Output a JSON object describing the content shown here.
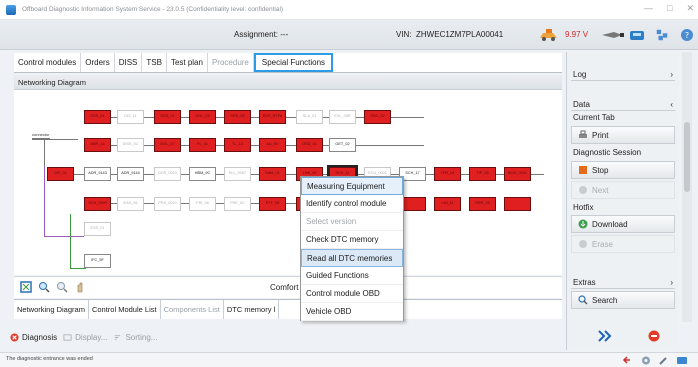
{
  "window": {
    "title": "Offboard Diagnostic Information System Service - 23.0.5 (Confidentiality level: confidential)"
  },
  "header": {
    "assignment_label": "Assignment:",
    "assignment_value": "---",
    "vin_label": "VIN:",
    "vin_value": "ZHWEC1ZM7PLA00041",
    "voltage": "9.97 V"
  },
  "tabs": [
    {
      "label": "Control modules",
      "state": "normal"
    },
    {
      "label": "Orders",
      "state": "normal"
    },
    {
      "label": "DISS",
      "state": "normal"
    },
    {
      "label": "TSB",
      "state": "normal"
    },
    {
      "label": "Test plan",
      "state": "normal"
    },
    {
      "label": "Procedure",
      "state": "disabled"
    },
    {
      "label": "Special Functions",
      "state": "active"
    }
  ],
  "network": {
    "title": "Networking Diagram",
    "connector_label": "connector",
    "node_labels": {
      "r1": [
        "DSS_01",
        "DIS_11",
        "ODS_01",
        "ODL_03",
        "SRS_05",
        "EDS_RTFA",
        "SLA_01",
        "EVL_06R",
        "SKD_02"
      ],
      "r2": [
        "ABR_14",
        "DISS_3C",
        "DOL_07",
        "PL_01",
        "TL_10",
        "AU_SV",
        "OSD_01",
        "GET_02"
      ],
      "r3": [
        "DIS_01",
        "ADR_9143",
        "ADR_9144",
        "DDS_0010",
        "HBM_9C",
        "ELL_0057",
        "SAM_01",
        "LNB_06",
        "SCH_12",
        "ECU_0001",
        "SCH_17",
        "TPR_04",
        "TIP_05",
        "BCM_0001"
      ],
      "r4": [
        "SCH_9999",
        "EAS_05",
        "PRS_0010",
        "PRI_06",
        "FRE_0C",
        "PTF_08",
        "TL_07",
        "LIM_11",
        "PER_16"
      ],
      "extra": [
        "ESS_01",
        "IFC_5F"
      ]
    }
  },
  "context_menu": {
    "items": [
      {
        "label": "Measuring Equipment",
        "state": "first"
      },
      {
        "label": "Identify control module",
        "state": "normal"
      },
      {
        "label": "Select version",
        "state": "disabled"
      },
      {
        "label": "Check DTC memory",
        "state": "normal"
      },
      {
        "label": "Read all DTC memories",
        "state": "hl"
      },
      {
        "label": "Guided Functions",
        "state": "normal"
      },
      {
        "label": "Control module OBD",
        "state": "normal"
      },
      {
        "label": "Vehicle OBD",
        "state": "normal"
      }
    ]
  },
  "toolstrip": {
    "comfort": "Comfort Sys"
  },
  "bottom_tabs": [
    {
      "label": "Networking Diagram",
      "state": "normal"
    },
    {
      "label": "Control Module List",
      "state": "normal"
    },
    {
      "label": "Components List",
      "state": "disabled"
    },
    {
      "label": "DTC memory l",
      "state": "normal"
    }
  ],
  "actions": {
    "diagnosis": "Diagnosis",
    "display": "Display...",
    "sorting": "Sorting..."
  },
  "status_message": "The diagnostic entrance was ended",
  "right_panel": {
    "log": "Log",
    "data": "Data",
    "current_tab": "Current Tab",
    "print": "Print",
    "diag_session": "Diagnostic Session",
    "stop": "Stop",
    "next": "Next",
    "hotfix": "Hotfix",
    "download": "Download",
    "erase": "Erase",
    "extras": "Extras",
    "search": "Search"
  }
}
